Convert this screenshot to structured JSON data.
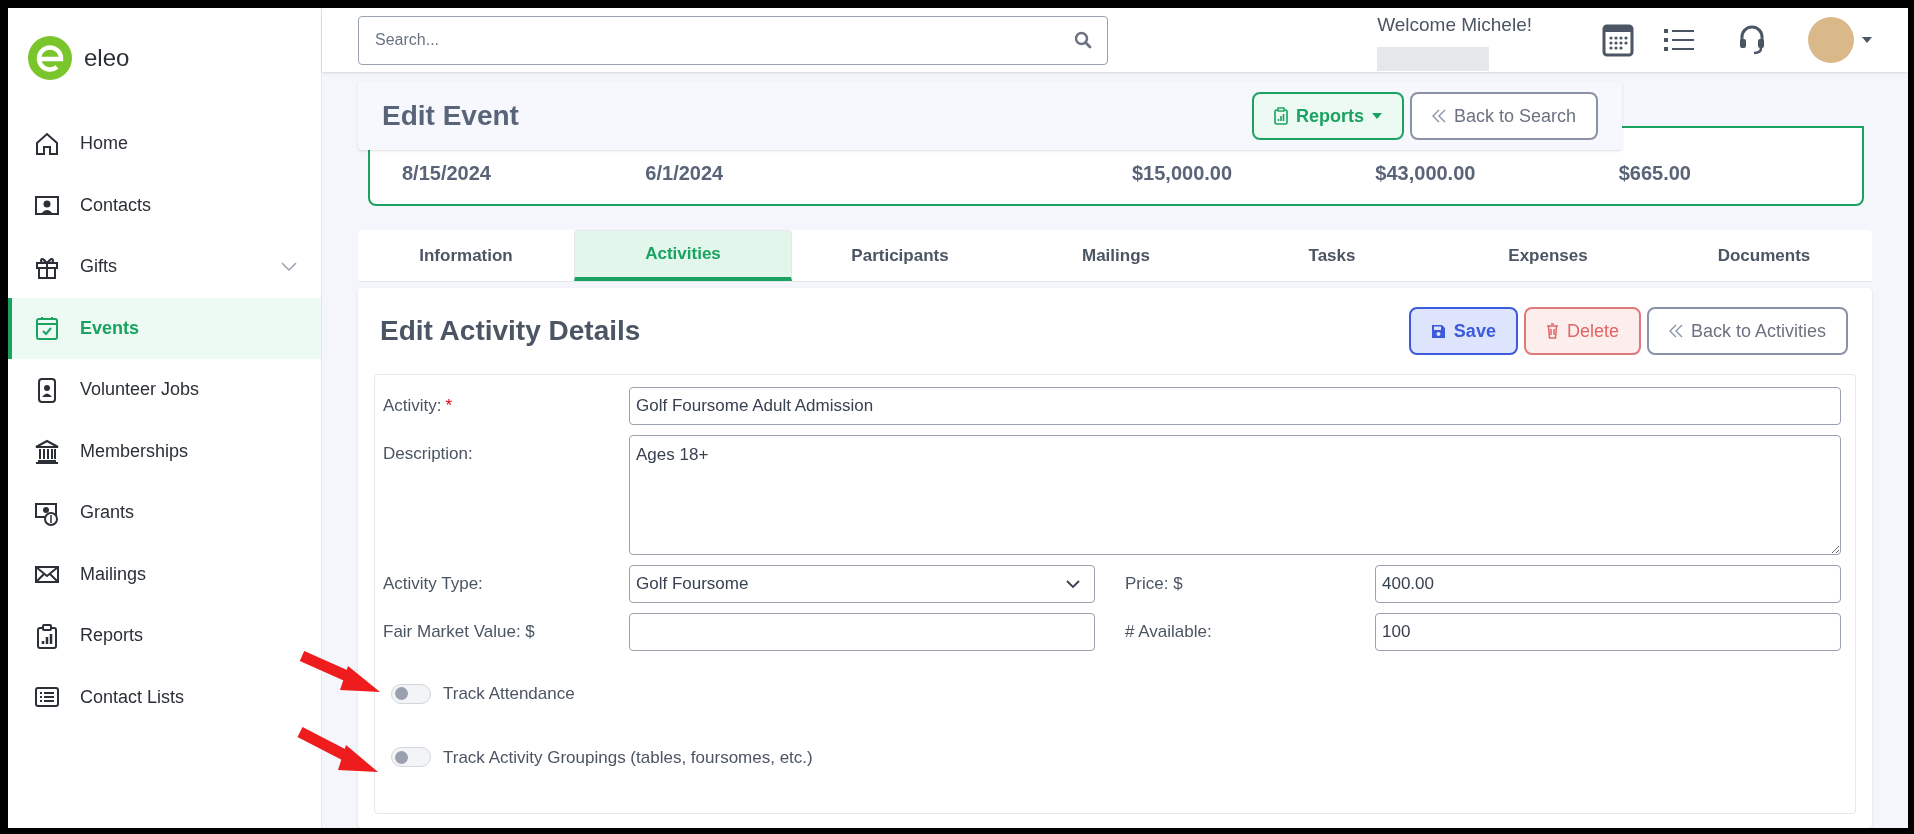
{
  "brand": {
    "name": "eleo"
  },
  "sidebar": {
    "items": [
      {
        "label": "Home",
        "selected": false,
        "has_submenu": false
      },
      {
        "label": "Contacts",
        "selected": false,
        "has_submenu": false
      },
      {
        "label": "Gifts",
        "selected": false,
        "has_submenu": true
      },
      {
        "label": "Events",
        "selected": true,
        "has_submenu": false
      },
      {
        "label": "Volunteer Jobs",
        "selected": false,
        "has_submenu": false
      },
      {
        "label": "Memberships",
        "selected": false,
        "has_submenu": false
      },
      {
        "label": "Grants",
        "selected": false,
        "has_submenu": false
      },
      {
        "label": "Mailings",
        "selected": false,
        "has_submenu": false
      },
      {
        "label": "Reports",
        "selected": false,
        "has_submenu": false
      },
      {
        "label": "Contact Lists",
        "selected": false,
        "has_submenu": false
      }
    ]
  },
  "search": {
    "placeholder": "Search..."
  },
  "user": {
    "greeting": "Welcome Michele!"
  },
  "header": {
    "title": "Edit Event",
    "buttons": [
      {
        "label": "Reports",
        "kind": "dropdown"
      },
      {
        "label": "Back to Search",
        "kind": "back"
      }
    ]
  },
  "summary": {
    "values": [
      "8/15/2024",
      "6/1/2024",
      "$15,000.00",
      "$43,000.00",
      "$665.00"
    ]
  },
  "tabs": [
    {
      "label": "Information",
      "selected": false
    },
    {
      "label": "Activities",
      "selected": true
    },
    {
      "label": "Participants",
      "selected": false
    },
    {
      "label": "Mailings",
      "selected": false
    },
    {
      "label": "Tasks",
      "selected": false
    },
    {
      "label": "Expenses",
      "selected": false
    },
    {
      "label": "Documents",
      "selected": false
    }
  ],
  "activity": {
    "title": "Edit Activity Details",
    "buttons": [
      {
        "label": "Save",
        "kind": "save"
      },
      {
        "label": "Delete",
        "kind": "delete"
      },
      {
        "label": "Back to Activities",
        "kind": "back"
      }
    ],
    "rows": [
      [
        {
          "label": "Activity:",
          "required_mark": "*",
          "kind": "text",
          "value": "Golf Foursome Adult Admission"
        }
      ],
      [
        {
          "label": "Description:",
          "kind": "textarea",
          "value": "Ages 18+"
        }
      ],
      [
        {
          "label": "Activity Type:",
          "kind": "select",
          "value": "Golf Foursome"
        },
        {
          "label": "Price: $",
          "kind": "text",
          "value": "400.00"
        }
      ],
      [
        {
          "label": "Fair Market Value: $",
          "kind": "text"
        },
        {
          "label": "# Available:",
          "kind": "text",
          "value": "100"
        }
      ]
    ],
    "toggles": [
      {
        "label": "Track Attendance",
        "on": false
      },
      {
        "label": "Track Activity Groupings (tables, foursomes, etc.)",
        "on": false
      }
    ]
  }
}
